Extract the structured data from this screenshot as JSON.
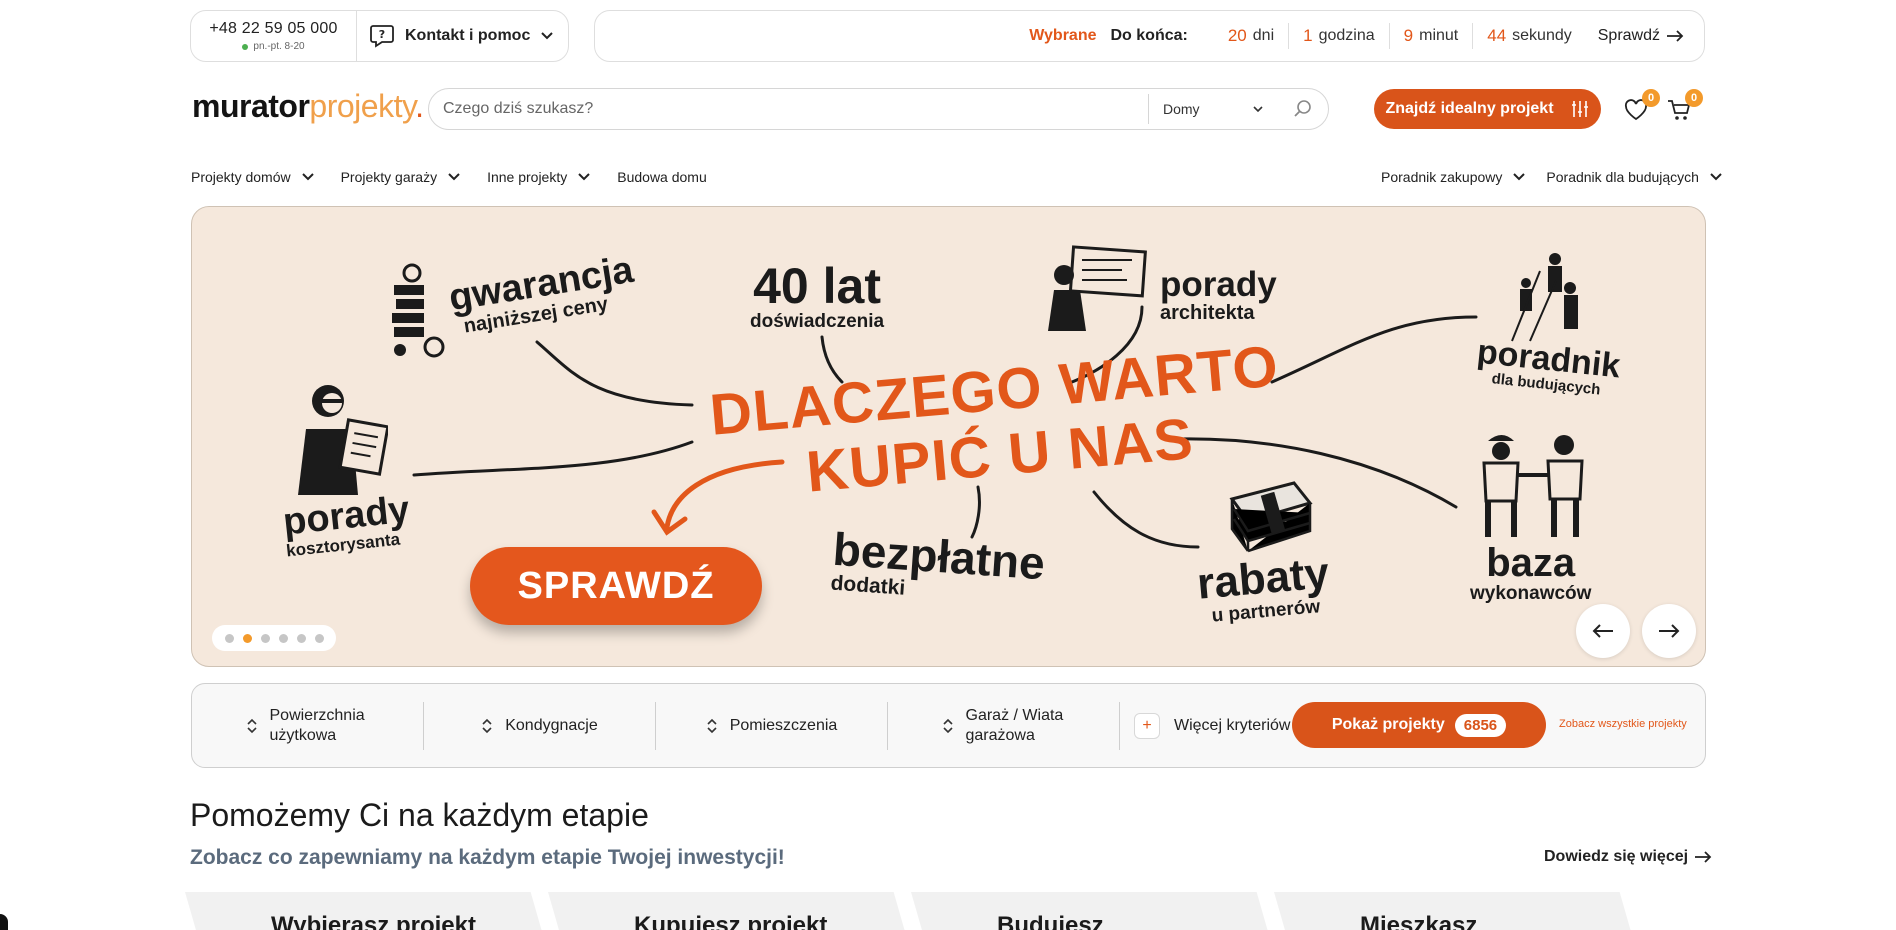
{
  "topbar": {
    "phone": "+48 22 59 05 000",
    "hours": "pn.-pt. 8-20",
    "help": "Kontakt i pomoc",
    "promo": {
      "wybrane": "Wybrane",
      "do_konca": "Do końca:",
      "days_n": "20",
      "days_l": "dni",
      "hours_n": "1",
      "hours_l": "godzina",
      "min_n": "9",
      "min_l": "minut",
      "sec_n": "44",
      "sec_l": "sekundy",
      "check": "Sprawdź"
    }
  },
  "header": {
    "logo_a": "murator",
    "logo_b": "projekty",
    "logo_c": ".",
    "search_placeholder": "Czego dziś szukasz?",
    "search_category": "Domy",
    "find_button": "Znajdź idealny projekt",
    "wishlist_count": "0",
    "cart_count": "0"
  },
  "nav": {
    "left": [
      "Projekty domów",
      "Projekty garaży",
      "Inne projekty",
      "Budowa domu"
    ],
    "right": [
      "Poradnik zakupowy",
      "Poradnik dla budujących"
    ]
  },
  "banner": {
    "gwarancja": "gwarancja",
    "najnizszej": "najniższej ceny",
    "lat": "40 lat",
    "doswiadczenia": "doświadczenia",
    "porady_a": "porady",
    "architekta": "architekta",
    "poradnik": "poradnik",
    "dla_budujacych": "dla budujących",
    "headline_1": "DLACZEGO WARTO",
    "headline_2": "KUPIĆ U NAS",
    "porady_k": "porady",
    "kosztorysanta": "kosztorysanta",
    "cta": "SPRAWDŹ",
    "bezplatne": "bezpłatne",
    "dodatki": "dodatki",
    "rabaty": "rabaty",
    "partnerow": "u partnerów",
    "baza": "baza",
    "wykonawcow": "wykonawców",
    "slides": 6,
    "active_slide": 2
  },
  "filters": {
    "items": [
      "Powierzchnia użytkowa",
      "Kondygnacje",
      "Pomieszczenia",
      "Garaż / Wiata garażowa"
    ],
    "more": "Więcej kryteriów",
    "show_button": "Pokaż projekty",
    "count": "6856",
    "all_link": "Zobacz wszystkie projekty"
  },
  "section": {
    "title": "Pomożemy Ci na każdym etapie",
    "subtitle": "Zobacz co zapewniamy na każdym etapie Twojej inwestycji!",
    "learn_more": "Dowiedz się więcej",
    "steps": [
      "Wybierasz projekt",
      "Kupujesz projekt",
      "Budujesz",
      "Mieszkasz"
    ]
  },
  "colors": {
    "accent": "#d9541a",
    "banner_bg": "#f5e8dc",
    "badge": "#f39a2b"
  }
}
